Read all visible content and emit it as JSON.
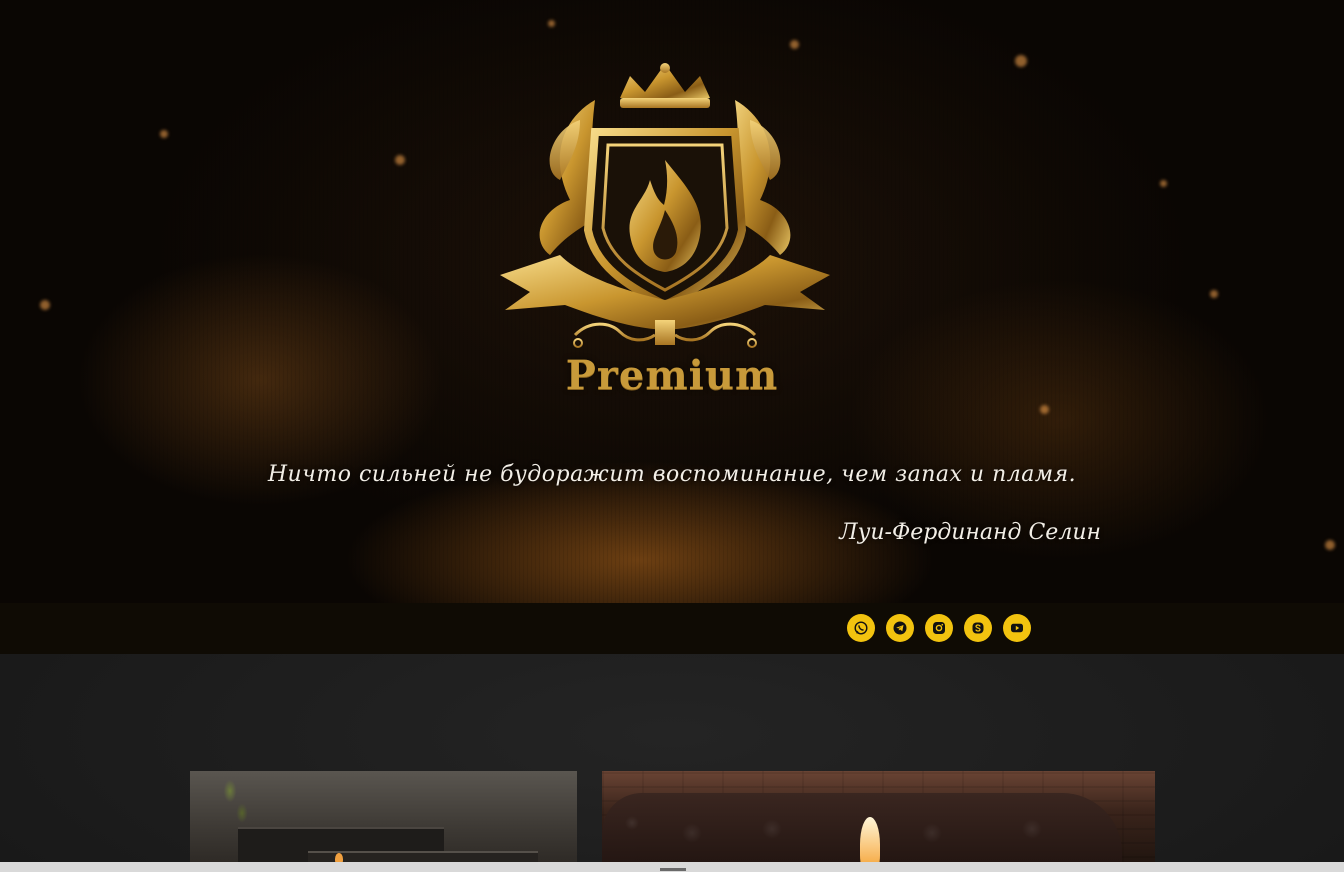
{
  "hero": {
    "brand_name": "Premium",
    "quote": "Ничто сильней не будоражит воспоминание, чем запах и пламя.",
    "author": "Луи-Фердинанд Селин"
  },
  "social": {
    "items": [
      {
        "name": "whatsapp",
        "icon": "whatsapp-icon"
      },
      {
        "name": "telegram",
        "icon": "telegram-icon"
      },
      {
        "name": "instagram",
        "icon": "instagram-icon"
      },
      {
        "name": "skype",
        "icon": "skype-icon"
      },
      {
        "name": "youtube",
        "icon": "youtube-icon"
      }
    ],
    "button_color": "#f2c30f"
  },
  "colors": {
    "gold": "#c89a3a",
    "bar_background": "#0f0b04",
    "content_background": "#1b1b1b"
  }
}
